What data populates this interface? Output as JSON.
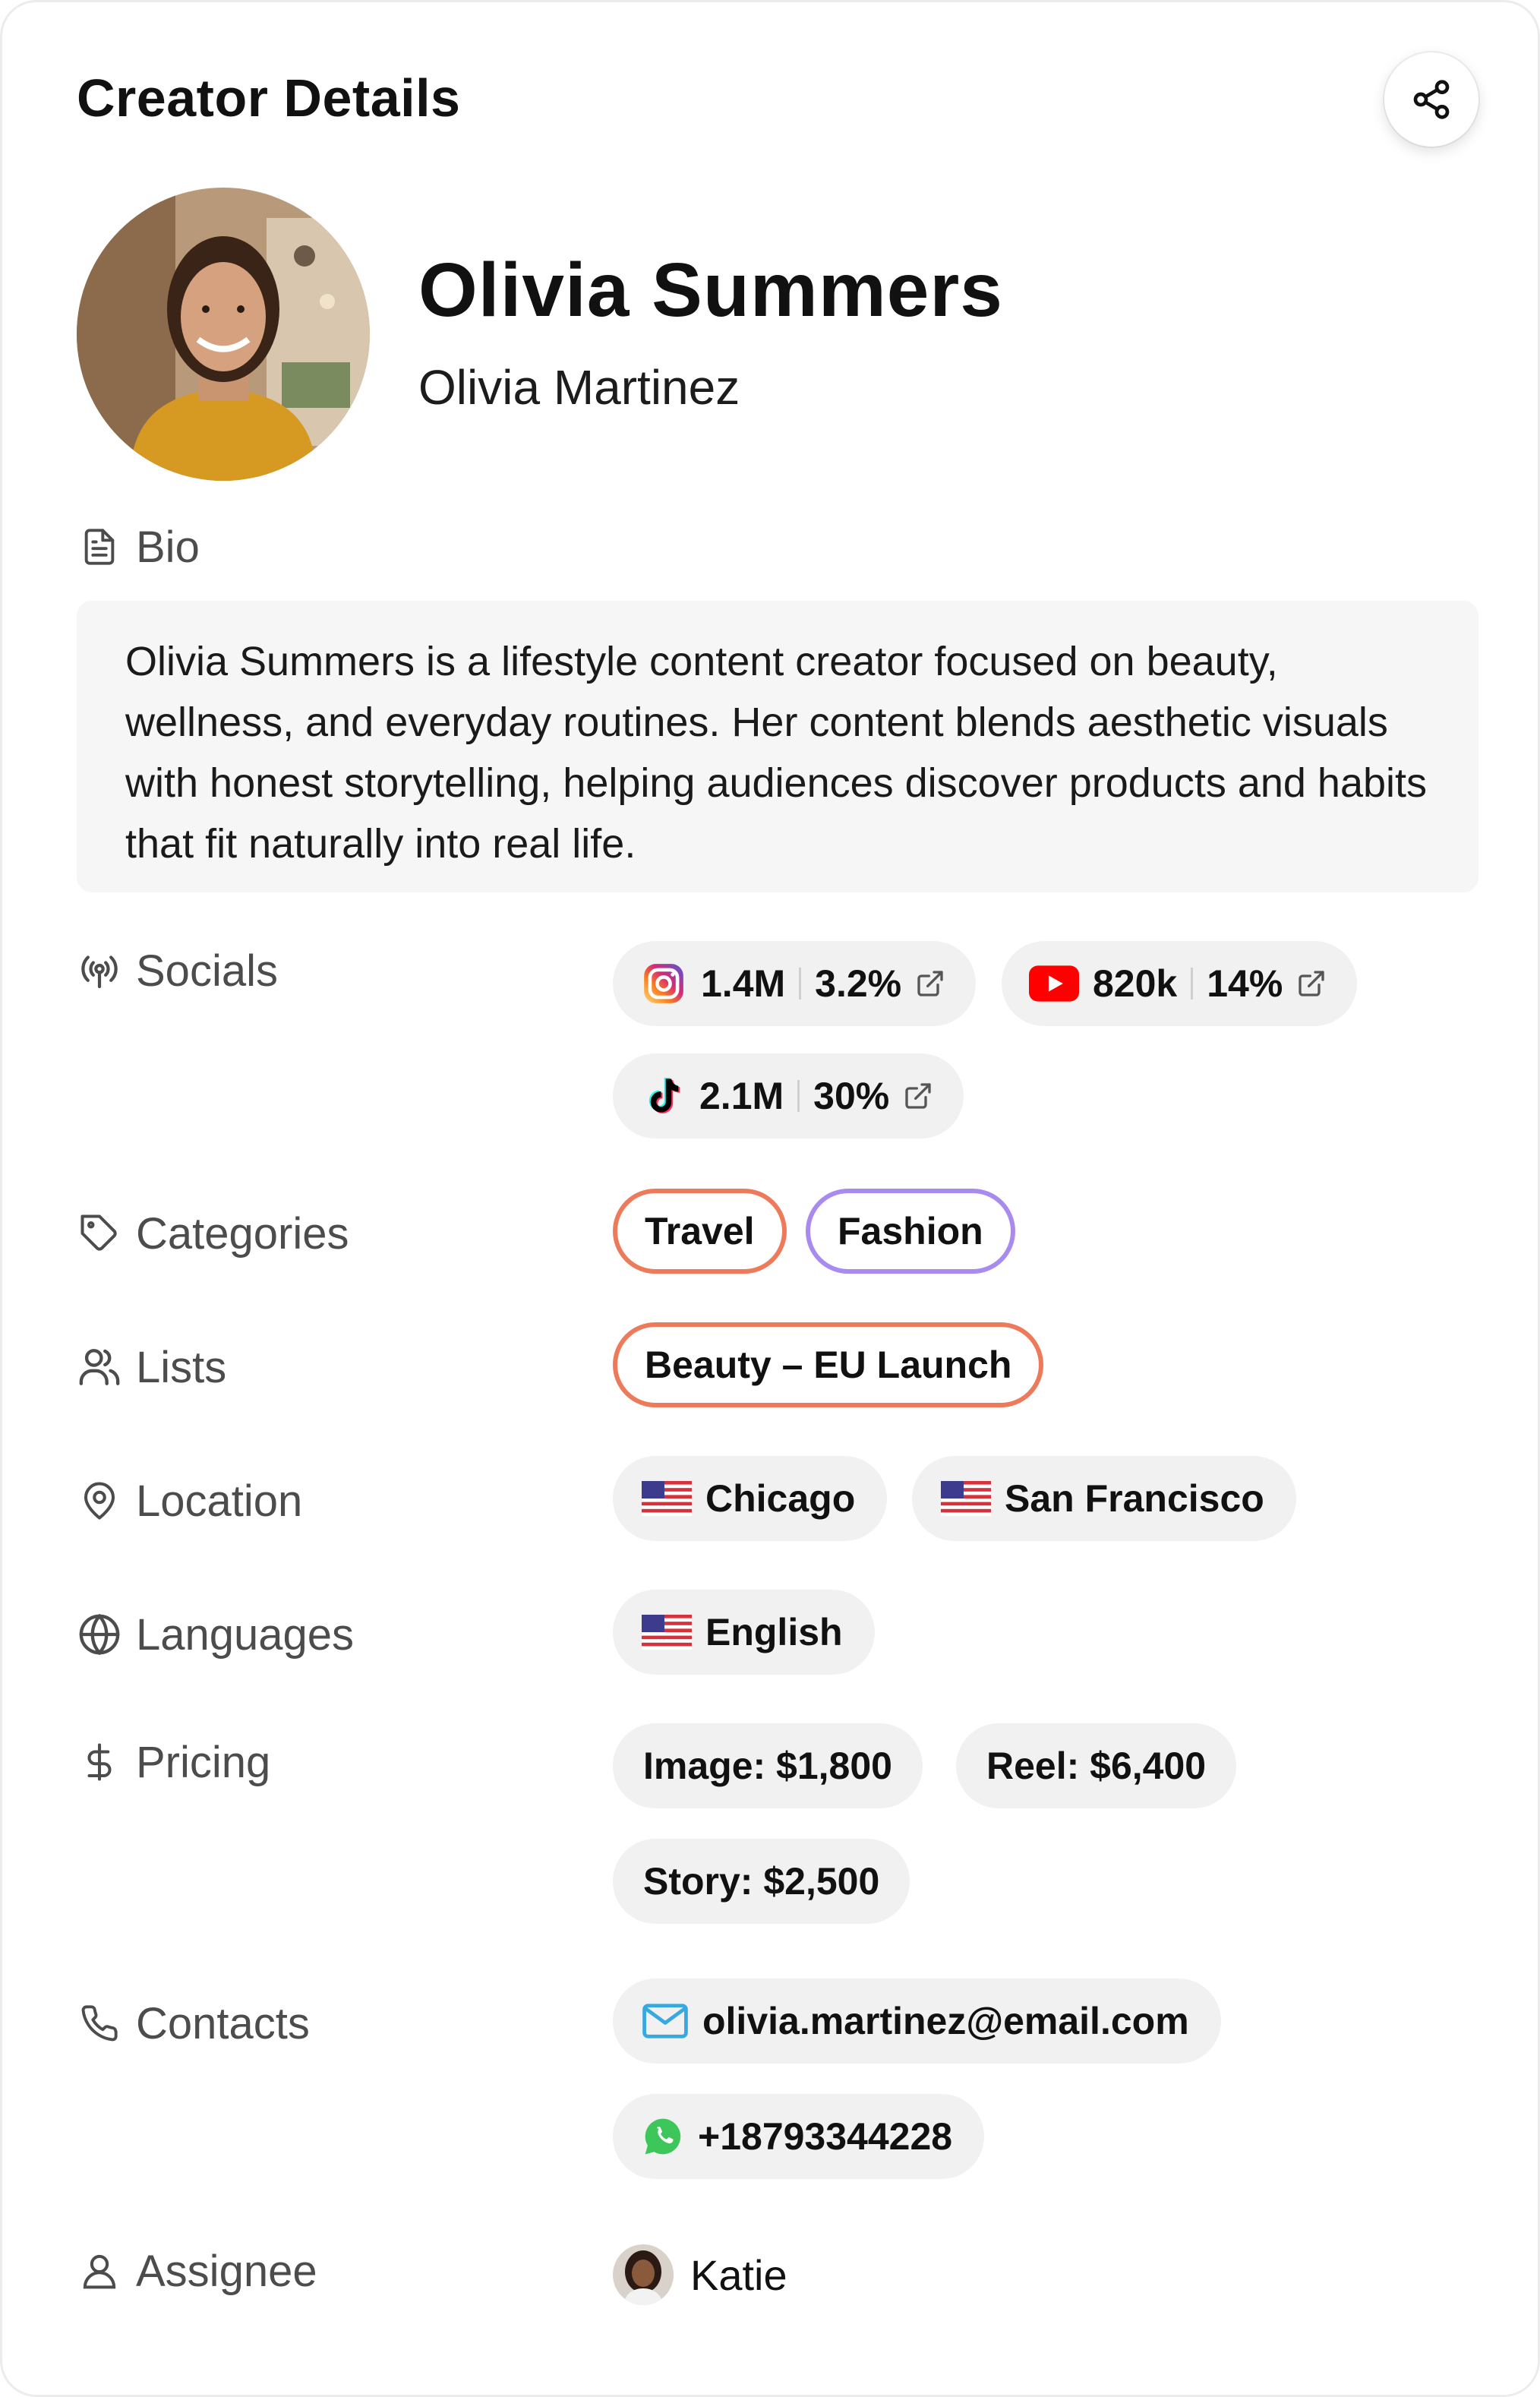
{
  "header": {
    "title": "Creator Details",
    "share_icon": "share-icon"
  },
  "profile": {
    "display_name": "Olivia Summers",
    "real_name": "Olivia Martinez"
  },
  "bio": {
    "label": "Bio",
    "text": "Olivia Summers is a lifestyle content creator focused on beauty, wellness, and everyday routines. Her content blends aesthetic visuals with honest storytelling, helping audiences discover products and habits that fit naturally into real life."
  },
  "socials": {
    "label": "Socials",
    "items": [
      {
        "platform": "instagram",
        "icon": "instagram-icon",
        "followers": "1.4M",
        "engagement": "3.2%"
      },
      {
        "platform": "youtube",
        "icon": "youtube-icon",
        "followers": "820k",
        "engagement": "14%"
      },
      {
        "platform": "tiktok",
        "icon": "tiktok-icon",
        "followers": "2.1M",
        "engagement": "30%"
      }
    ]
  },
  "categories": {
    "label": "Categories",
    "items": [
      {
        "name": "Travel",
        "color": "#EE7A5C"
      },
      {
        "name": "Fashion",
        "color": "#A98BF0"
      }
    ]
  },
  "lists": {
    "label": "Lists",
    "items": [
      {
        "name": "Beauty – EU Launch",
        "color": "#EE7A5C"
      }
    ]
  },
  "location": {
    "label": "Location",
    "items": [
      {
        "city": "Chicago",
        "flag": "us-flag"
      },
      {
        "city": "San Francisco",
        "flag": "us-flag"
      }
    ]
  },
  "languages": {
    "label": "Languages",
    "items": [
      {
        "name": "English",
        "flag": "us-flag"
      }
    ]
  },
  "pricing": {
    "label": "Pricing",
    "items": [
      "Image: $1,800",
      "Reel: $6,400",
      "Story: $2,500"
    ]
  },
  "contacts": {
    "label": "Contacts",
    "email": "olivia.martinez@email.com",
    "phone": "+18793344228"
  },
  "assignee": {
    "label": "Assignee",
    "name": "Katie"
  },
  "colors": {
    "label_gray": "#4c4c4c",
    "pill_bg": "#f1f1f1",
    "instagram": "#D62976",
    "youtube": "#FF0000",
    "email_blue": "#38A8E0",
    "whatsapp_green": "#3DC75A"
  }
}
